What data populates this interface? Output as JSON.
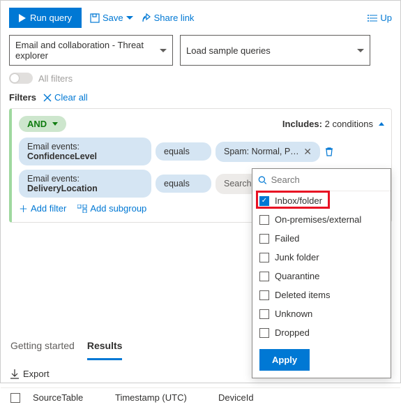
{
  "toolbar": {
    "run": "Run query",
    "save": "Save",
    "share": "Share link",
    "up": "Up"
  },
  "scope_dd": "Email and collaboration - Threat explorer",
  "sample_dd": "Load sample queries",
  "all_filters": "All filters",
  "filters_label": "Filters",
  "clear_all": "Clear all",
  "group": {
    "operator": "AND",
    "includes_label": "Includes:",
    "includes_value": "2 conditions",
    "rows": [
      {
        "field_prefix": "Email events: ",
        "field": "ConfidenceLevel",
        "op": "equals",
        "value": "Spam: Normal, Phish: High"
      },
      {
        "field_prefix": "Email events: ",
        "field": "DeliveryLocation",
        "op": "equals",
        "value_placeholder": "Search"
      }
    ],
    "add_filter": "Add filter",
    "add_subgroup": "Add subgroup"
  },
  "tabs": {
    "getting_started": "Getting started",
    "results": "Results"
  },
  "export": "Export",
  "table": {
    "col1": "SourceTable",
    "col2": "Timestamp (UTC)",
    "col3": "DeviceId"
  },
  "dropdown": {
    "search_placeholder": "Search",
    "options": [
      "Inbox/folder",
      "On-premises/external",
      "Failed",
      "Junk folder",
      "Quarantine",
      "Deleted items",
      "Unknown",
      "Dropped"
    ],
    "apply": "Apply"
  }
}
